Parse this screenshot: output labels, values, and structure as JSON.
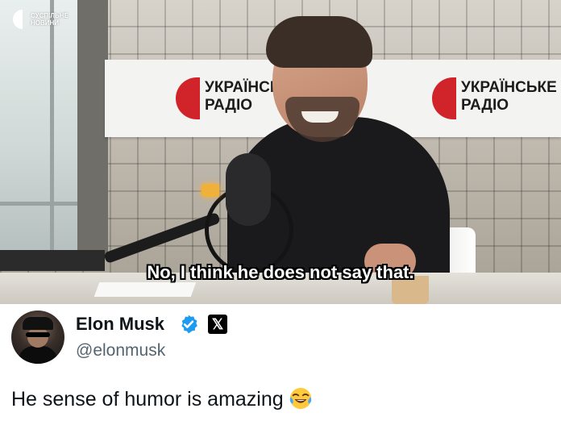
{
  "video": {
    "broadcaster_logo_text": "СУСПІЛЬНЕ НОВИНИ",
    "studio_sign_left": "УКРАЇНСЬ\nРАДІО",
    "studio_sign_right": "УКРАЇНСЬКЕ\nРАДІО",
    "subtitle": "No, I think he does not say that."
  },
  "tweet": {
    "display_name": "Elon Musk",
    "handle": "@elonmusk",
    "badges": [
      "verified-badge-icon",
      "x-logo-icon"
    ],
    "text": "He sense of humor is amazing",
    "emoji": "face-with-tears-of-joy-icon",
    "colors": {
      "verified": "#1d9bf0",
      "name": "#0f1419",
      "handle": "#536471"
    }
  }
}
